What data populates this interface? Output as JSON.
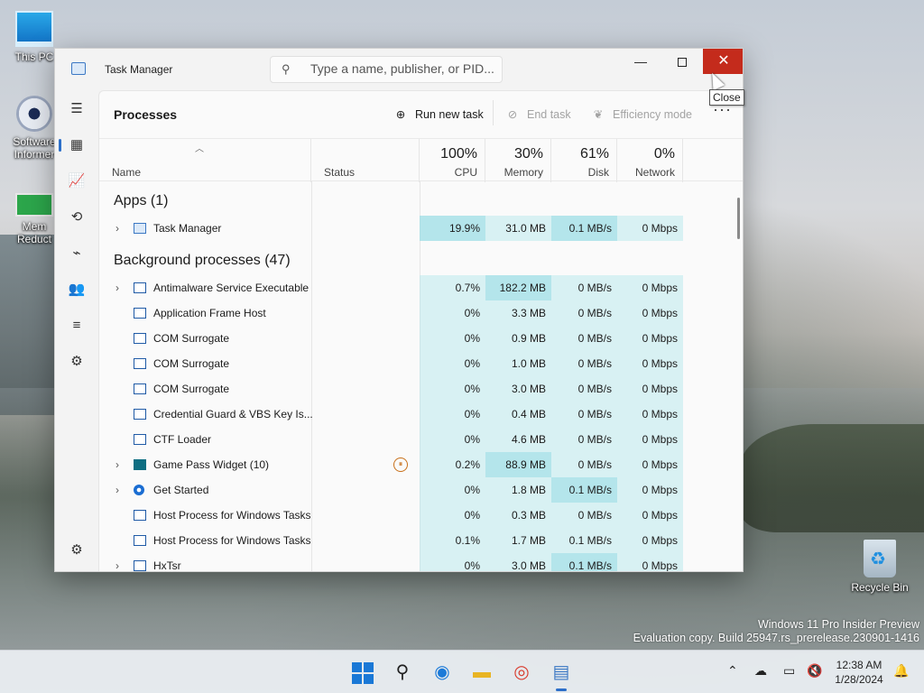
{
  "desktop": {
    "icons": [
      {
        "label": "This PC"
      },
      {
        "label": "Software Informer"
      },
      {
        "label": "Mem Reduct"
      },
      {
        "label": "Recycle Bin"
      }
    ],
    "watermark_line1": "Windows 11 Pro Insider Preview",
    "watermark_line2": "Evaluation copy. Build 25947.rs_prerelease.230901-1416"
  },
  "window": {
    "title": "Task Manager",
    "search_placeholder": "Type a name, publisher, or PID...",
    "close_tooltip": "Close",
    "controls": {
      "minimize": "—",
      "maximize": "",
      "close": "✕"
    }
  },
  "sidebar": {
    "items": [
      {
        "name": "hamburger-menu-icon",
        "glyph": "☰"
      },
      {
        "name": "processes-icon",
        "glyph": "▦"
      },
      {
        "name": "performance-icon",
        "glyph": "📈"
      },
      {
        "name": "app-history-icon",
        "glyph": "⟲"
      },
      {
        "name": "startup-apps-icon",
        "glyph": "⌁"
      },
      {
        "name": "users-icon",
        "glyph": "👥"
      },
      {
        "name": "details-icon",
        "glyph": "≡"
      },
      {
        "name": "services-icon",
        "glyph": "⚙"
      }
    ],
    "settings_glyph": "⚙"
  },
  "commandbar": {
    "page_title": "Processes",
    "run_new_task": "Run new task",
    "end_task": "End task",
    "efficiency_mode": "Efficiency mode",
    "more": "···"
  },
  "columns": {
    "name": "Name",
    "status": "Status",
    "cpu_pct": "100%",
    "cpu": "CPU",
    "memory_pct": "30%",
    "memory": "Memory",
    "disk_pct": "61%",
    "disk": "Disk",
    "network_pct": "0%",
    "network": "Network"
  },
  "sections": {
    "apps": "Apps (1)",
    "background": "Background processes (47)"
  },
  "apps": [
    {
      "name": "Task Manager",
      "cpu": "19.9%",
      "memory": "31.0 MB",
      "disk": "0.1 MB/s",
      "network": "0 Mbps",
      "expandable": true
    }
  ],
  "background": [
    {
      "name": "Antimalware Service Executable",
      "cpu": "0.7%",
      "memory": "182.2 MB",
      "disk": "0 MB/s",
      "network": "0 Mbps",
      "expandable": true
    },
    {
      "name": "Application Frame Host",
      "cpu": "0%",
      "memory": "3.3 MB",
      "disk": "0 MB/s",
      "network": "0 Mbps",
      "expandable": false
    },
    {
      "name": "COM Surrogate",
      "cpu": "0%",
      "memory": "0.9 MB",
      "disk": "0 MB/s",
      "network": "0 Mbps",
      "expandable": false
    },
    {
      "name": "COM Surrogate",
      "cpu": "0%",
      "memory": "1.0 MB",
      "disk": "0 MB/s",
      "network": "0 Mbps",
      "expandable": false
    },
    {
      "name": "COM Surrogate",
      "cpu": "0%",
      "memory": "3.0 MB",
      "disk": "0 MB/s",
      "network": "0 Mbps",
      "expandable": false
    },
    {
      "name": "Credential Guard & VBS Key Is...",
      "cpu": "0%",
      "memory": "0.4 MB",
      "disk": "0 MB/s",
      "network": "0 Mbps",
      "expandable": false
    },
    {
      "name": "CTF Loader",
      "cpu": "0%",
      "memory": "4.6 MB",
      "disk": "0 MB/s",
      "network": "0 Mbps",
      "expandable": false
    },
    {
      "name": "Game Pass Widget (10)",
      "cpu": "0.2%",
      "memory": "88.9 MB",
      "disk": "0 MB/s",
      "network": "0 Mbps",
      "expandable": true,
      "status_glyph": "⏸"
    },
    {
      "name": "Get Started",
      "cpu": "0%",
      "memory": "1.8 MB",
      "disk": "0.1 MB/s",
      "network": "0 Mbps",
      "expandable": true
    },
    {
      "name": "Host Process for Windows Tasks",
      "cpu": "0%",
      "memory": "0.3 MB",
      "disk": "0 MB/s",
      "network": "0 Mbps",
      "expandable": false
    },
    {
      "name": "Host Process for Windows Tasks",
      "cpu": "0.1%",
      "memory": "1.7 MB",
      "disk": "0.1 MB/s",
      "network": "0 Mbps",
      "expandable": false
    },
    {
      "name": "HxTsr",
      "cpu": "0%",
      "memory": "3.0 MB",
      "disk": "0.1 MB/s",
      "network": "0 Mbps",
      "expandable": true
    }
  ],
  "taskbar": {
    "clock_time": "12:38 AM",
    "clock_date": "1/28/2024",
    "tray_chevron": "⌃"
  },
  "colors": {
    "close_red": "#c42b1c",
    "accent": "#2c6fc9",
    "heat_light": "#cdeef1",
    "heat_strong": "#a6e0e6"
  }
}
